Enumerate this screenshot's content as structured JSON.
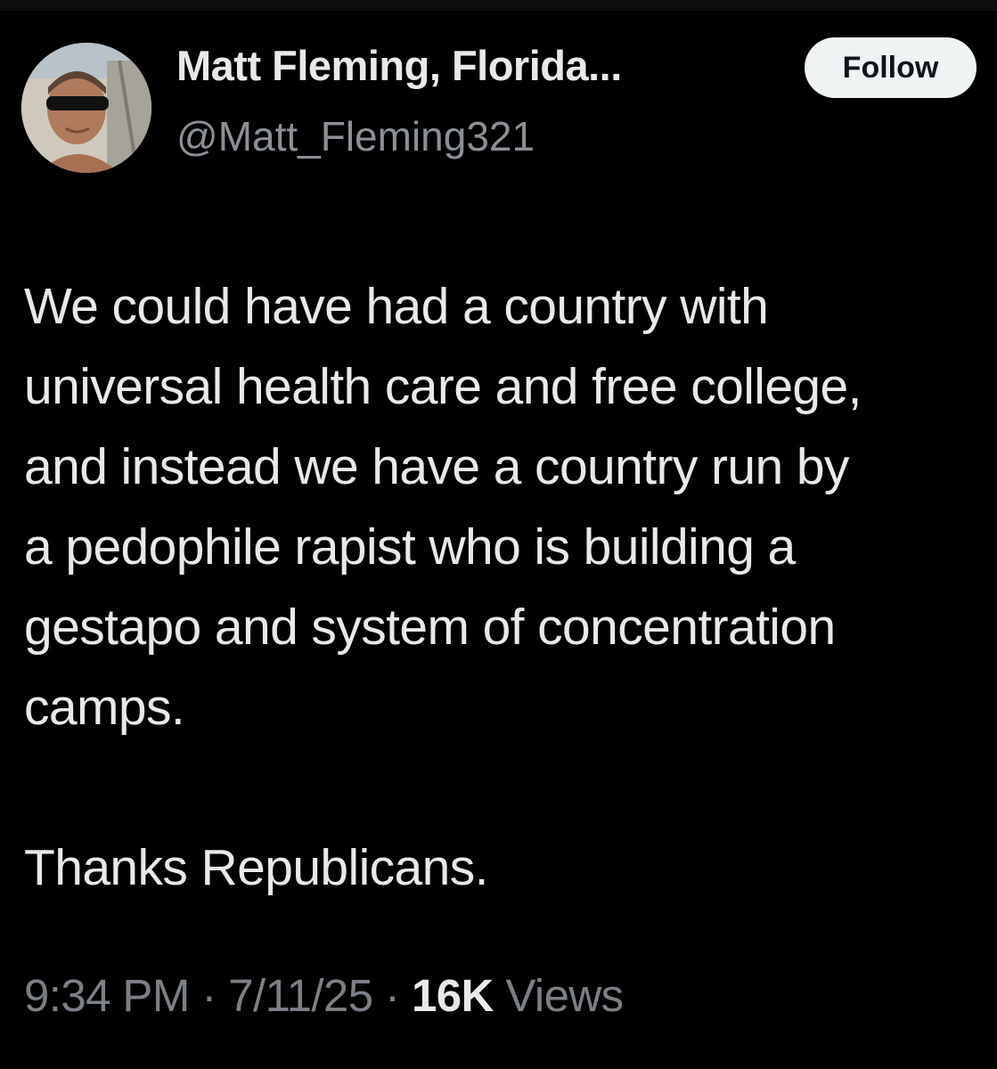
{
  "author": {
    "display_name": "Matt Fleming, Florida...",
    "handle": "@Matt_Fleming321",
    "follow_label": "Follow"
  },
  "tweet": {
    "text": "We could have had a country with\nuniversal health care and free college,\nand instead we have a country run by\na pedophile rapist who is building a\ngestapo and system of concentration\ncamps.\n\nThanks Republicans.",
    "time": "9:34 PM",
    "separator": "·",
    "date": "7/11/25",
    "views_count": "16K",
    "views_label": "Views"
  },
  "colors": {
    "background": "#000000",
    "text_primary": "#e7e9ea",
    "text_secondary": "#7b8086",
    "follow_button_bg": "#eff3f4"
  },
  "icons": {
    "avatar": "profile-photo"
  }
}
